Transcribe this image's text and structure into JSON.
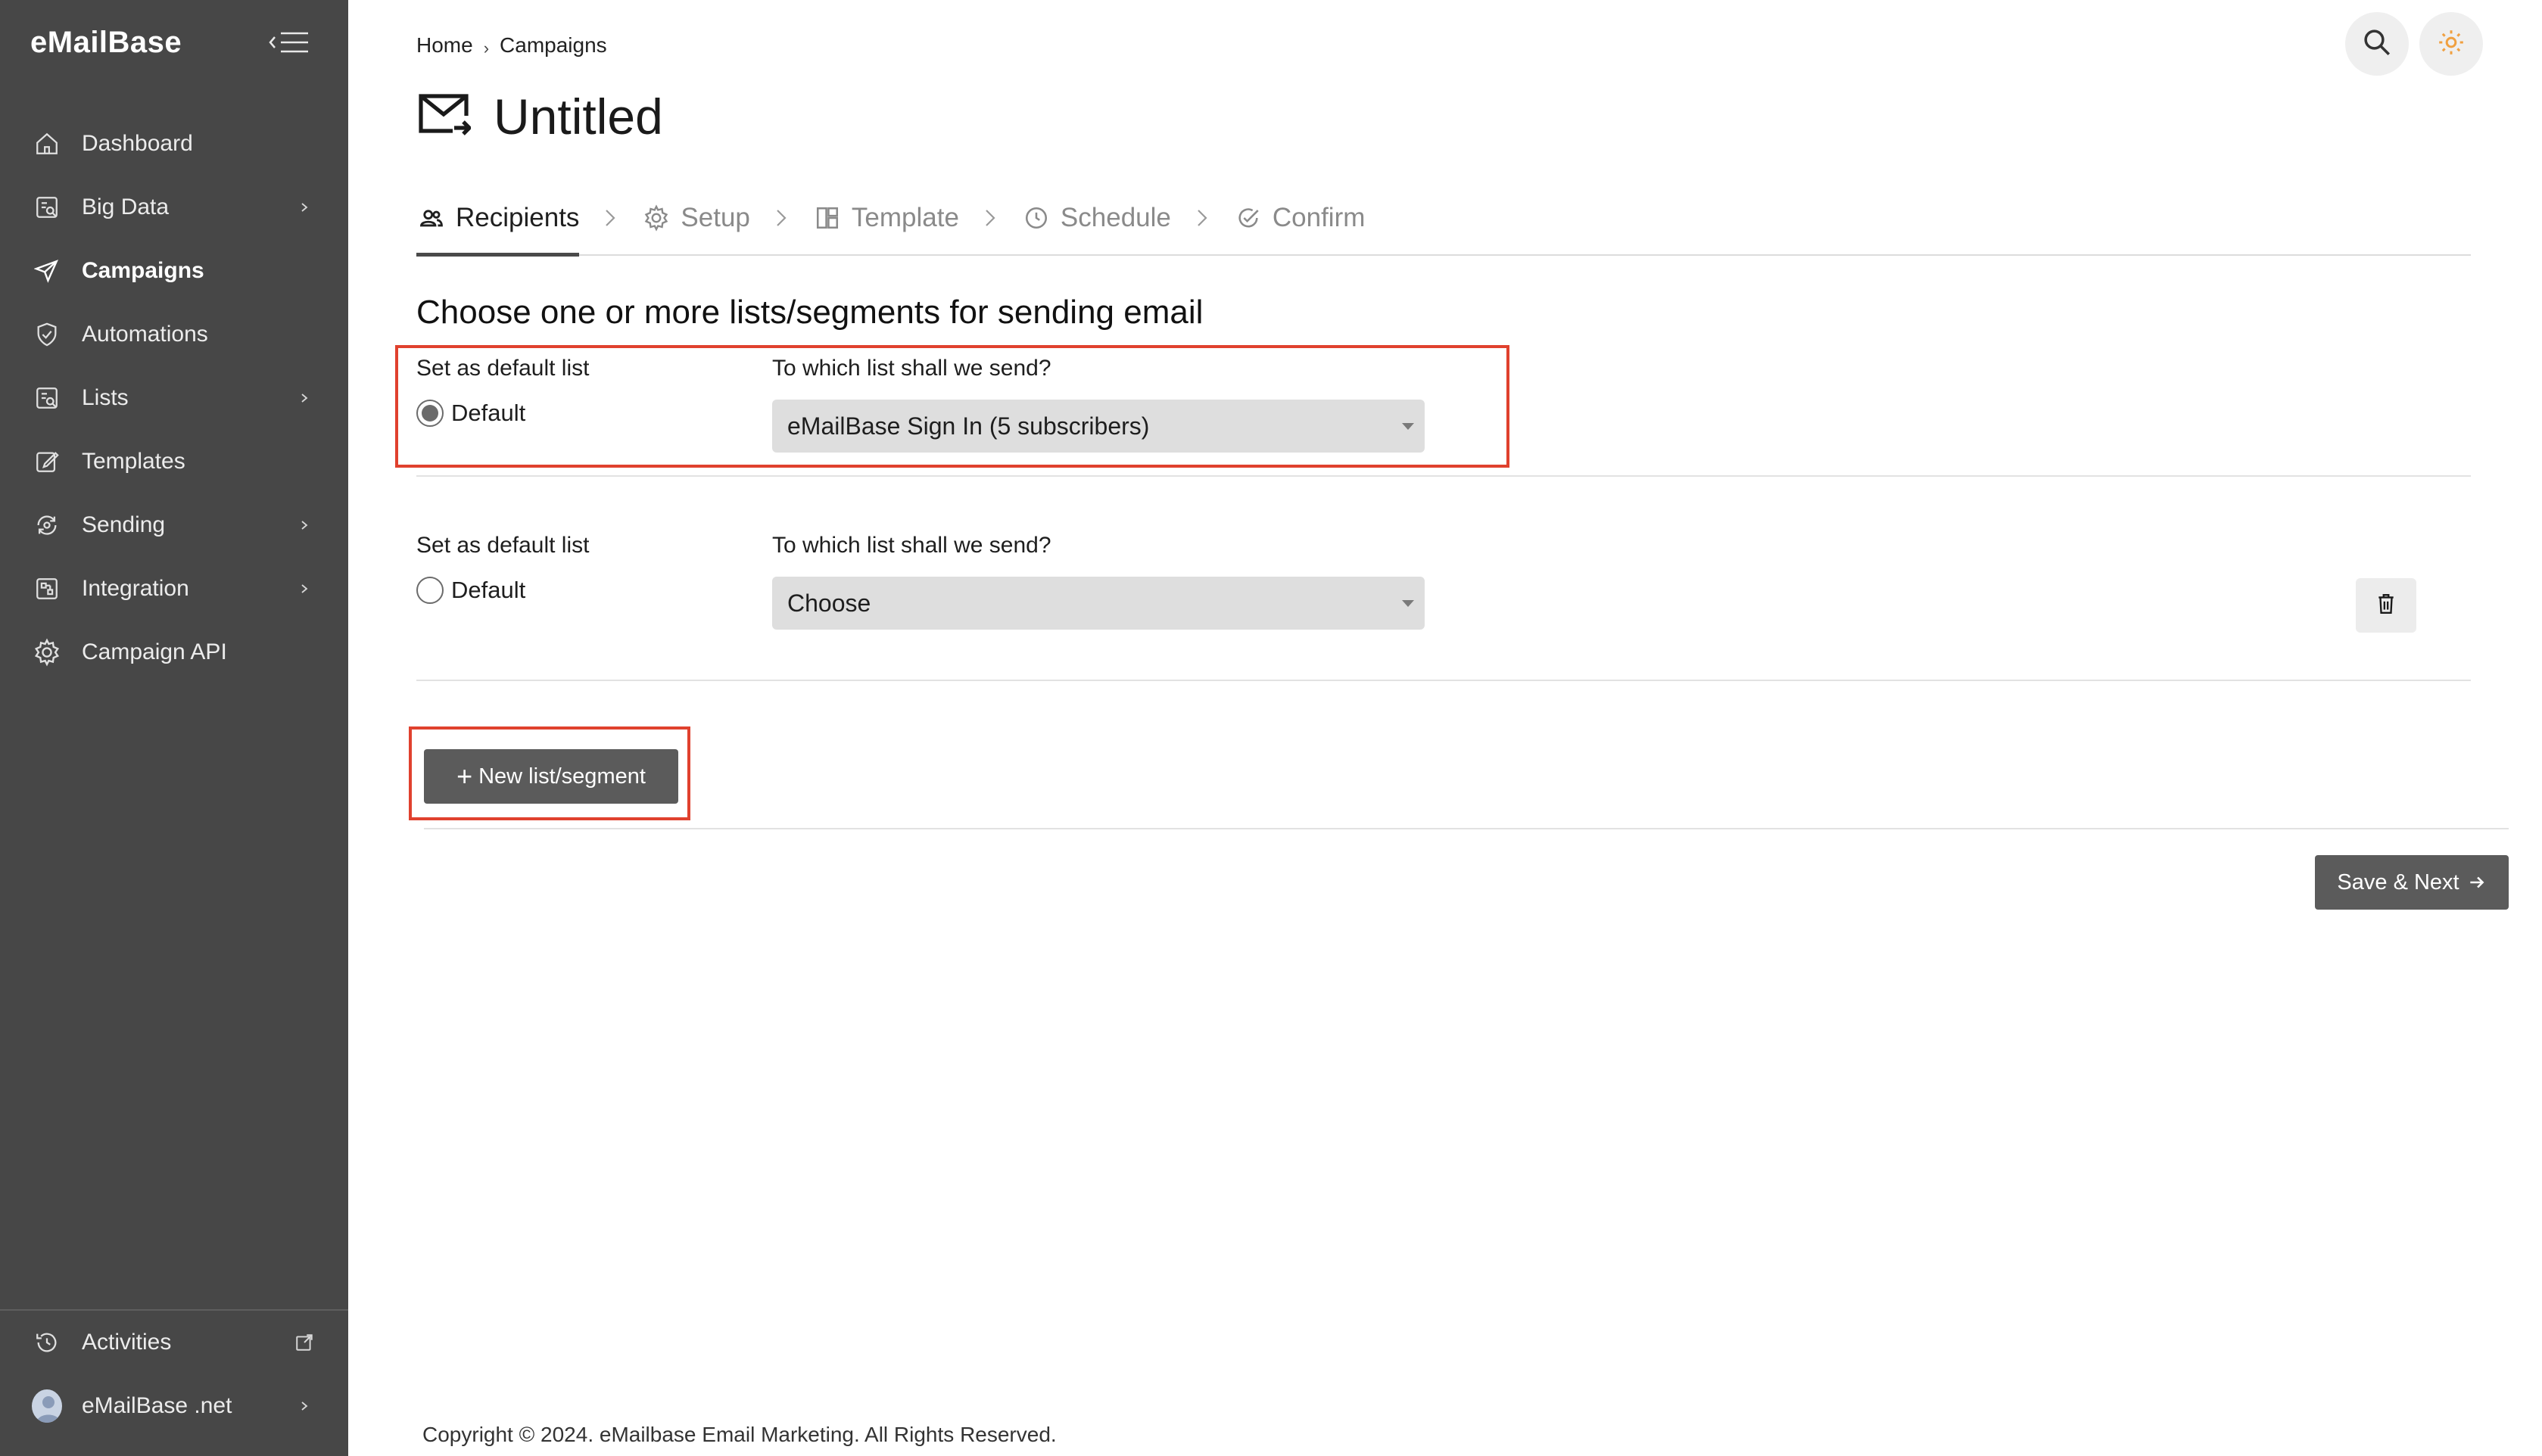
{
  "sidebar": {
    "brand": "eMailBase",
    "items": [
      {
        "label": "Dashboard",
        "icon": "home-icon"
      },
      {
        "label": "Big Data",
        "icon": "data-icon"
      },
      {
        "label": "Campaigns",
        "icon": "send-icon"
      },
      {
        "label": "Automations",
        "icon": "automation-icon"
      },
      {
        "label": "Lists",
        "icon": "list-icon"
      },
      {
        "label": "Templates",
        "icon": "template-edit-icon"
      },
      {
        "label": "Sending",
        "icon": "sending-icon"
      },
      {
        "label": "Integration",
        "icon": "integration-icon"
      },
      {
        "label": "Campaign API",
        "icon": "gear-icon"
      }
    ],
    "bottom": {
      "activities_label": "Activities",
      "account_label": "eMailBase .net"
    }
  },
  "breadcrumb": {
    "home": "Home",
    "separator": "›",
    "current": "Campaigns"
  },
  "page": {
    "title": "Untitled"
  },
  "steps": [
    {
      "label": "Recipients",
      "state": "active"
    },
    {
      "label": "Setup",
      "state": "inactive"
    },
    {
      "label": "Template",
      "state": "inactive"
    },
    {
      "label": "Schedule",
      "state": "inactive"
    },
    {
      "label": "Confirm",
      "state": "inactive"
    }
  ],
  "content": {
    "heading": "Choose one or more lists/segments for sending email",
    "rows": [
      {
        "default_label": "Set as default list",
        "radio_label": "Default",
        "radio_checked": true,
        "list_label": "To which list shall we send?",
        "list_value": "eMailBase Sign In (5 subscribers)"
      },
      {
        "default_label": "Set as default list",
        "radio_label": "Default",
        "radio_checked": false,
        "list_label": "To which list shall we send?",
        "list_value": "Choose"
      }
    ],
    "new_list_button": "New list/segment",
    "save_button": "Save & Next"
  },
  "footer": {
    "copyright": "Copyright © 2024. eMailbase Email Marketing. All Rights Reserved."
  },
  "colors": {
    "sidebar_bg": "#474747",
    "button_bg": "#5b5b5b",
    "highlight": "#e0412e",
    "theme_icon": "#f0a040"
  }
}
